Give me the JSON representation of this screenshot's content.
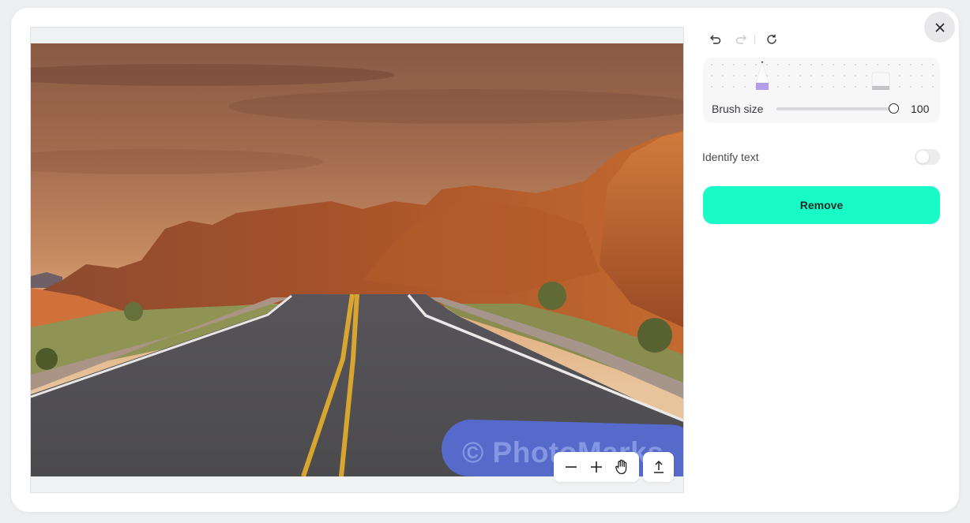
{
  "dialog": {
    "close_label": "Close"
  },
  "canvas": {
    "watermark_text": "© PhotoMarks",
    "photo_subject": "desert road through red rock canyon at sunset",
    "mask_color": "#586edc",
    "controls": {
      "zoom_out_icon": "minus-icon",
      "zoom_in_icon": "plus-icon",
      "pan_icon": "hand-icon",
      "export_icon": "upload-icon"
    }
  },
  "panel": {
    "history": {
      "undo_icon": "undo-icon",
      "redo_icon": "redo-icon",
      "reset_icon": "refresh-icon",
      "redo_enabled": false
    },
    "tools": {
      "pencil": {
        "name": "Brush",
        "color": "#b59ce8",
        "selected": true
      },
      "eraser": {
        "name": "Eraser",
        "selected": false
      }
    },
    "brush_size": {
      "label": "Brush size",
      "value": "100",
      "fraction": 1.0
    },
    "identify_text": {
      "label": "Identify text",
      "enabled": false
    },
    "remove_button": {
      "label": "Remove",
      "color": "#19fbc7"
    }
  }
}
